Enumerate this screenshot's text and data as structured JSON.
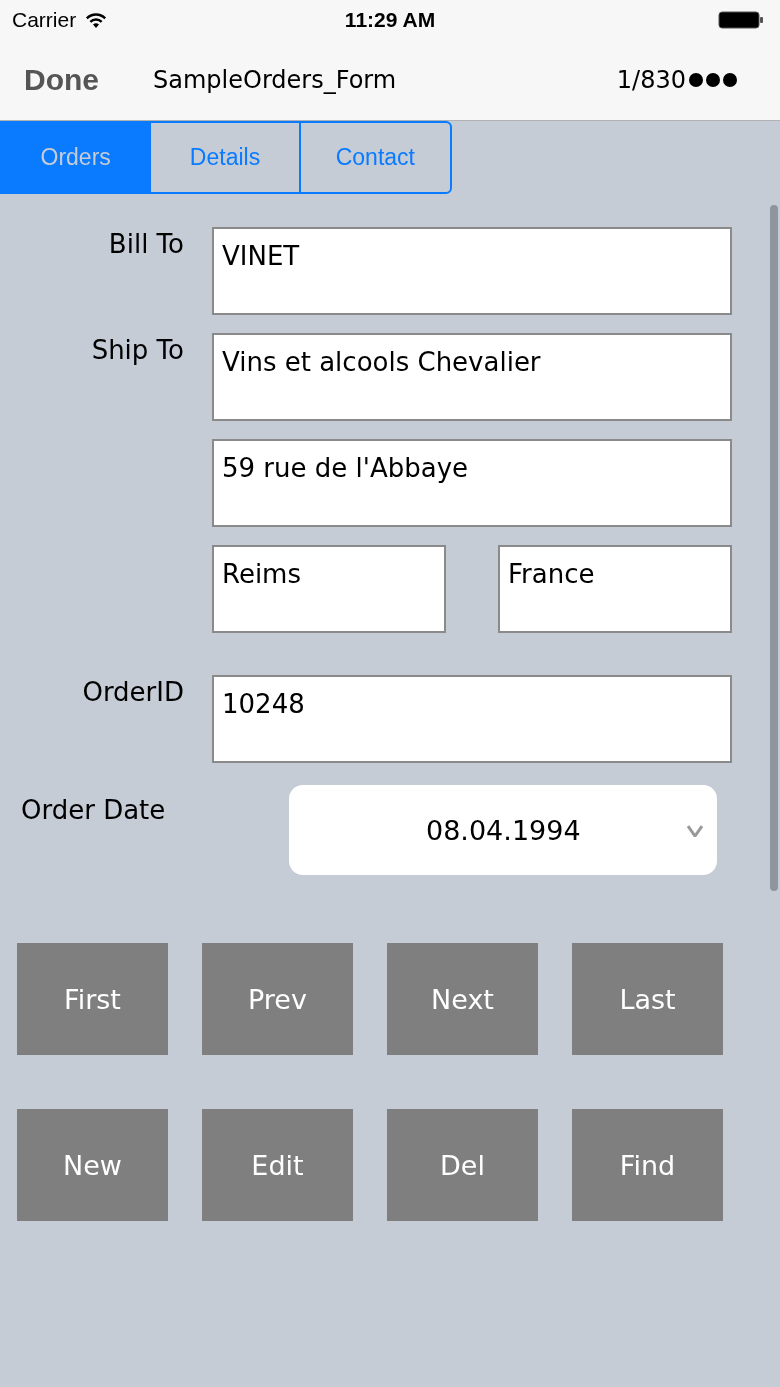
{
  "status_bar": {
    "carrier": "Carrier",
    "time": "11:29 AM"
  },
  "nav_bar": {
    "done": "Done",
    "title": "SampleOrders_Form",
    "record": "1/830"
  },
  "tabs": [
    {
      "label": "Orders",
      "selected": true
    },
    {
      "label": "Details",
      "selected": false
    },
    {
      "label": "Contact",
      "selected": false
    }
  ],
  "form_rows": [
    {
      "label": "Bill To",
      "fields": [
        {
          "value": "VINET"
        }
      ]
    },
    {
      "label": "Ship To",
      "fields": [
        {
          "value": "Vins et alcools Chevalier"
        }
      ]
    },
    {
      "fields": [
        {
          "value": "59 rue de l'Abbaye"
        }
      ]
    },
    {
      "fields": [
        {
          "value": "Reims"
        },
        {
          "value": "France"
        }
      ]
    },
    {
      "label": "OrderID",
      "fields": [
        {
          "value": "10248"
        }
      ]
    }
  ],
  "order_date": {
    "label": "Order Date",
    "value": "08.04.1994"
  },
  "button_rows": [
    [
      "First",
      "Prev",
      "Next",
      "Last"
    ],
    [
      "New",
      "Edit",
      "Del",
      "Find"
    ]
  ]
}
